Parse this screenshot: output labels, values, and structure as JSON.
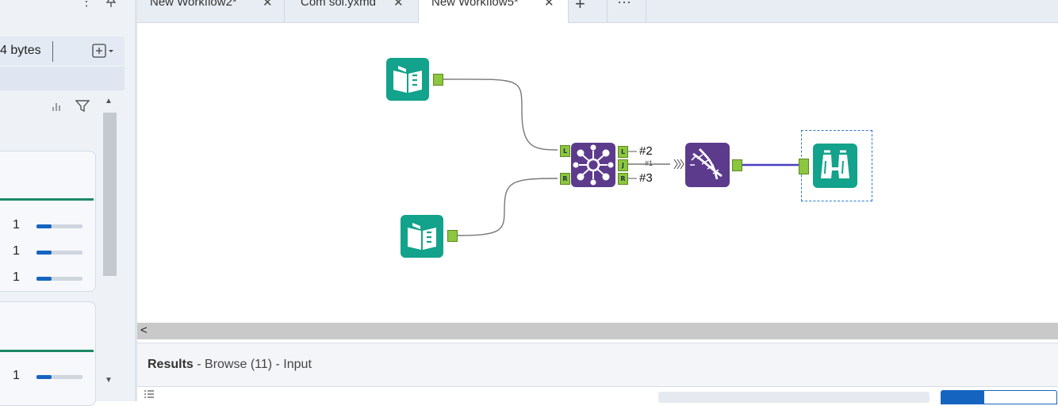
{
  "left_panel": {
    "record_size": "4 bytes",
    "header_more_icon": "vertical-ellipsis-icon",
    "header_pin_icon": "pin-icon",
    "add_field_icon": "add-field-dropdown-icon",
    "chart_icon": "bar-chart-icon",
    "filter_icon": "filter-icon",
    "cards": [
      {
        "rows": [
          {
            "value": "1",
            "fill": 0.33
          },
          {
            "value": "1",
            "fill": 0.33
          },
          {
            "value": "1",
            "fill": 0.33
          }
        ]
      },
      {
        "rows": [
          {
            "value": "1",
            "fill": 0.33
          }
        ]
      }
    ]
  },
  "tabs": [
    {
      "label": "New Workflow2*",
      "active": false
    },
    {
      "label": "Com sol.yxmd",
      "active": false
    },
    {
      "label": "New Workflow5*",
      "active": true
    }
  ],
  "tab_close_glyph": "✕",
  "tab_add_glyph": "+",
  "tab_more_glyph": "···",
  "canvas": {
    "tools": {
      "input1": {
        "icon": "input-data-book-icon",
        "color": "#13a28b"
      },
      "input2": {
        "icon": "input-data-book-icon",
        "color": "#13a28b"
      },
      "join": {
        "icon": "join-network-icon",
        "color": "#5d3b8c",
        "anchors_in": [
          "L",
          "R"
        ],
        "anchors_out": [
          "L",
          "J",
          "R"
        ]
      },
      "select": {
        "icon": "dna-select-icon",
        "color": "#5d3b8c"
      },
      "browse": {
        "icon": "binoculars-browse-icon",
        "color": "#13a28b",
        "selected": true
      }
    },
    "join_output_labels": {
      "left": "#2",
      "right": "#3",
      "join": "#1"
    },
    "wire_color": "#4a3fbf"
  },
  "hscroll": {
    "left_glyph": "<"
  },
  "results": {
    "title": "Results",
    "subtitle": "- Browse (11) - Input",
    "list_icon": "list-icon"
  }
}
